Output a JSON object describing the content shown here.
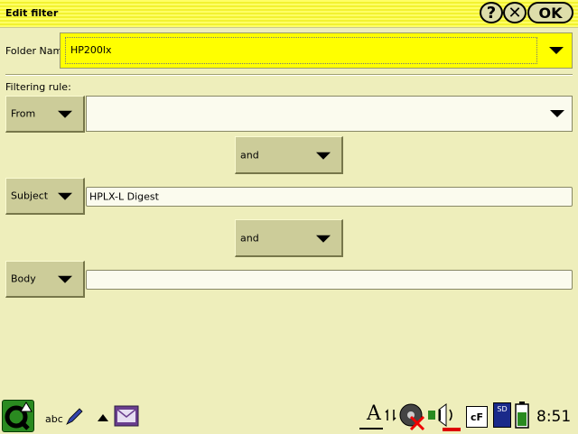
{
  "window": {
    "title": "Edit filter",
    "help_label": "?",
    "close_label": "✕",
    "ok_label": "OK"
  },
  "folder": {
    "label": "Folder Name",
    "value": "HP200lx"
  },
  "filtering_rule_label": "Filtering rule:",
  "rules": [
    {
      "field": "From",
      "value": ""
    },
    {
      "field": "Subject",
      "value": "HPLX-L Digest"
    },
    {
      "field": "Body",
      "value": ""
    }
  ],
  "connectors": [
    "and",
    "and"
  ],
  "taskbar": {
    "input_method_label": "abc",
    "clock": "8:51",
    "cf_label": "cF",
    "sd_label": "SD",
    "font_indicator": "A"
  },
  "colors": {
    "background": "#eeeebb",
    "titlebar": "#ffff66",
    "folder_highlight": "#ffff00",
    "button_face": "#cccc99"
  },
  "icons": [
    "help-icon",
    "close-icon",
    "q-launcher-icon",
    "pencil-icon",
    "arrow-up-icon",
    "mail-icon",
    "font-icon",
    "network-icon",
    "cd-disc-icon",
    "speaker-icon",
    "cf-card-icon",
    "sd-card-icon",
    "battery-icon"
  ]
}
